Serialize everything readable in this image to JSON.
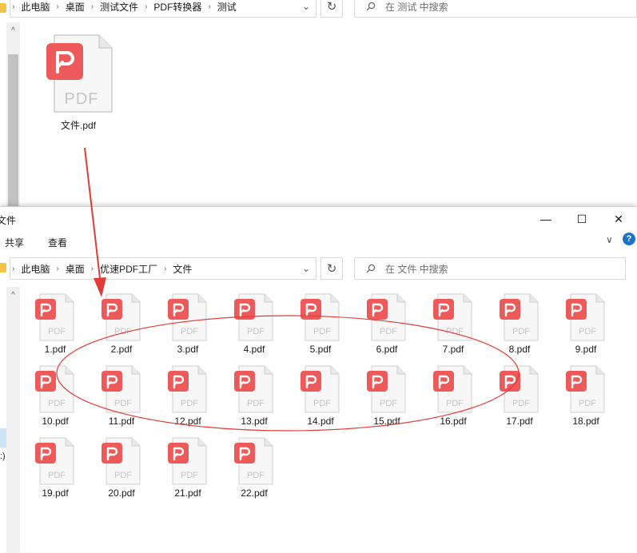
{
  "top_window": {
    "breadcrumb": [
      "此电脑",
      "桌面",
      "测试文件",
      "PDF转换器",
      "测试"
    ],
    "search_placeholder": "在 测试 中搜索",
    "file": {
      "name": "文件.pdf",
      "icon": "pdf-file-icon",
      "badge_text": "PDF"
    }
  },
  "main_window": {
    "title": "文件",
    "controls": {
      "minimize": "—",
      "maximize": "☐",
      "close": "✕"
    },
    "ribbon_tabs": [
      "共享",
      "查看"
    ],
    "ribbon_expand": "∨",
    "help": "?",
    "breadcrumb": [
      "此电脑",
      "桌面",
      "优速PDF工厂",
      "文件"
    ],
    "search_placeholder": "在 文件 中搜索",
    "left_pane_fragment": ":)",
    "files": [
      "1.pdf",
      "2.pdf",
      "3.pdf",
      "4.pdf",
      "5.pdf",
      "6.pdf",
      "7.pdf",
      "8.pdf",
      "9.pdf",
      "10.pdf",
      "11.pdf",
      "12.pdf",
      "13.pdf",
      "14.pdf",
      "15.pdf",
      "16.pdf",
      "17.pdf",
      "18.pdf",
      "19.pdf",
      "20.pdf",
      "21.pdf",
      "22.pdf"
    ],
    "file_badge_text": "PDF"
  },
  "annotation": {
    "color": "#e03b36"
  },
  "colors": {
    "pdf_red": "#ee5a5a",
    "page_gray": "#f5f5f5",
    "page_border": "#cfcfcf",
    "pdf_text": "#c6c6c6"
  }
}
